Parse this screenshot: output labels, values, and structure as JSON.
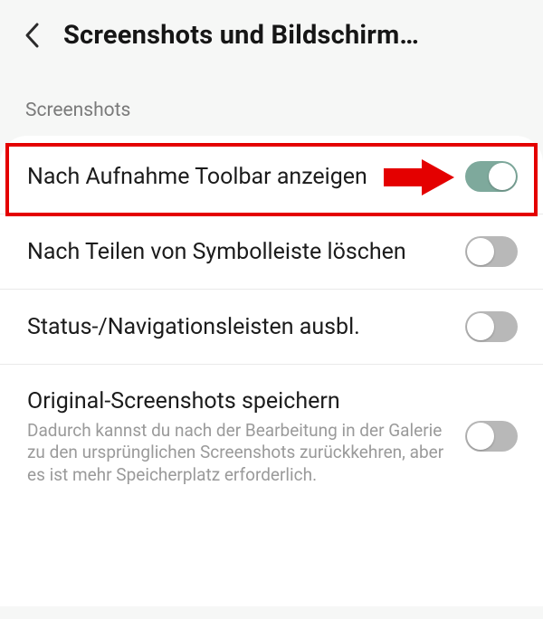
{
  "header": {
    "title": "Screenshots und Bildschirm…"
  },
  "section": {
    "label": "Screenshots"
  },
  "rows": [
    {
      "label": "Nach Aufnahme Toolbar anzeigen",
      "desc": "",
      "on": true,
      "highlighted": true
    },
    {
      "label": "Nach Teilen von Symbolleiste löschen",
      "desc": "",
      "on": false,
      "highlighted": false
    },
    {
      "label": "Status-/Navigationsleisten ausbl.",
      "desc": "",
      "on": false,
      "highlighted": false
    },
    {
      "label": "Original-Screenshots speichern",
      "desc": "Dadurch kannst du nach der Bearbeitung in der Galerie zu den ursprünglichen Screenshots zurückkehren, aber es ist mehr Speicherplatz erforderlich.",
      "on": false,
      "highlighted": false
    }
  ],
  "colors": {
    "toggle_on": "#7ea99c",
    "toggle_off": "#b8b8b8",
    "highlight": "#e40000"
  }
}
